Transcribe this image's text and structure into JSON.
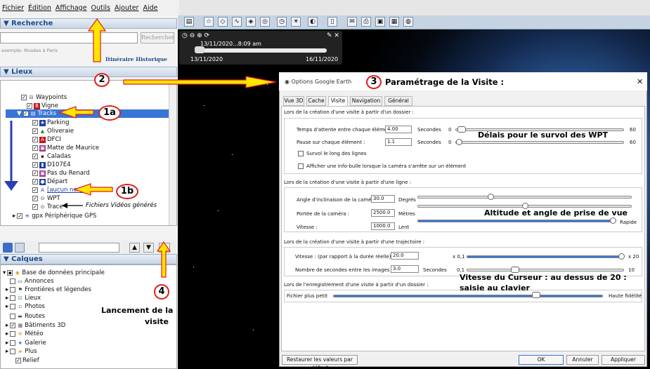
{
  "menu": [
    "Fichier",
    "Édition",
    "Affichage",
    "Outils",
    "Ajouter",
    "Aide"
  ],
  "left": {
    "search_header": "▼ Recherche",
    "search_button": "Rechercher",
    "search_hint": "exemple: Musées à Paris",
    "itinerary": "Itinéraire",
    "history": "Historique",
    "places_header": "▼ Lieux",
    "tree": [
      "Waypoints",
      "Vigne",
      "Tracks",
      "Parking",
      "Oliveraie",
      "DFCI",
      "Matte de Maurice",
      "Caladas",
      "D107E4",
      "Pas du Renard",
      "Départ",
      "[aucun nom]",
      "WPT",
      "Trace",
      "gpx Périphérique GPS"
    ],
    "layers_header": "▼ Calques",
    "layers": [
      "Base de données principale",
      "Annonces",
      "Frontières et légendes",
      "Lieux",
      "Photos",
      "Routes",
      "Bâtiments 3D",
      "Météo",
      "Galerie",
      "Plus",
      "Relief"
    ]
  },
  "timeline": {
    "time": "13/11/2020...8:09 am",
    "start": "13/11/2020",
    "end": "16/11/2020"
  },
  "dialog": {
    "title": "Options Google Earth",
    "tabs": [
      "Vue 3D",
      "Cache",
      "Visite",
      "Navigation",
      "Général"
    ],
    "sec1": "Lors de la création d'une visite à partir d'un dossier :",
    "wait_label": "Temps d'attente entre chaque élément :",
    "wait_val": "4.00",
    "seconds": "Secondes",
    "wait_min": "0",
    "wait_max": "60",
    "pause_label": "Pause sur chaque élément :",
    "pause_val": "1.1",
    "pause_min": "0",
    "pause_max": "60",
    "lines_label": "Survol le long des lignes",
    "bubble_label": "Afficher une info-bulle lorsque la caméra s'arrête sur un élément",
    "sec2": "Lors de la création d'une visite à partir d'une ligne :",
    "angle_label": "Angle d'inclinaison de la caméra :",
    "angle_val": "30.0",
    "degrees": "Degrés",
    "range_label": "Portée de la caméra :",
    "range_val": "2500.0",
    "meters": "Mètres",
    "speed_label": "Vitesse :",
    "speed_val": "1000.0",
    "slow": "Lent",
    "fast": "Rapide",
    "sec3": "Lors de la création d'une visite à partir d'une trajectoire :",
    "tspeed_label": "Vitesse : (par rapport à la durée réelle)",
    "tspeed_val": "20.0",
    "tmin": "x 0,1",
    "tmax": "x 20",
    "keys_label": "Nombre de secondes entre les images clés :",
    "keys_val": "3.0",
    "kmin": "0,1",
    "kmax": "10",
    "sec4": "Lors de l'enregistrement d'une visite à partir d'un dossier :",
    "small": "Fichier plus petit",
    "hifi": "Haute fidélité",
    "restore": "Restaurer les valeurs par défaut",
    "ok": "OK",
    "cancel": "Annuler",
    "apply": "Appliquer"
  },
  "annotations": {
    "n1a": "1a",
    "n1b": "1b",
    "n2": "2",
    "n3": "3",
    "n4": "4",
    "title3": "Paramétrage de la Visite :",
    "wpt": "Délais pour le survol des WPT",
    "alt": "Altitude et angle de prise de vue",
    "cursor1": "Vitesse du Curseur : au dessus de 20 :",
    "cursor2": "saisie au clavier",
    "videos": "Fichiers Vidéos générés",
    "launch1": "Lancement de la",
    "launch2": "visite"
  },
  "colors": {
    "selection": "#3875d7",
    "annotation_red": "#e31d1d",
    "arrow_yellow": "#ffe600",
    "arrow_blue": "#2b3fb5"
  }
}
